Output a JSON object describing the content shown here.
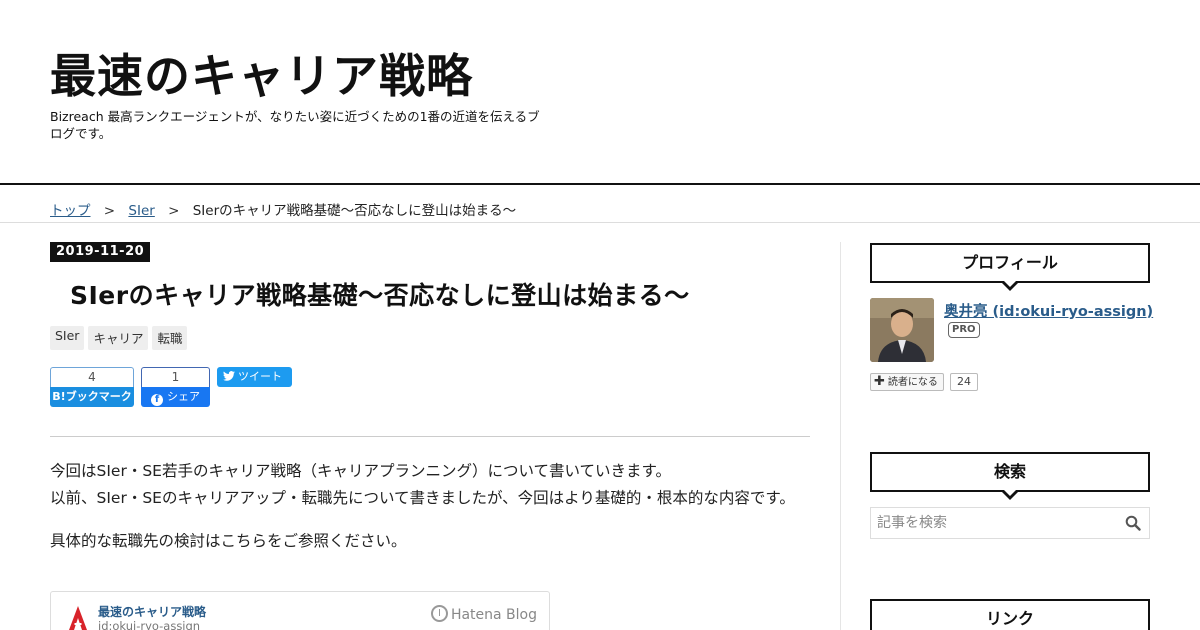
{
  "header": {
    "title": "最速のキャリア戦略",
    "description": "Bizreach 最高ランクエージェントが、なりたい姿に近づくための1番の近道を伝えるブログです。"
  },
  "breadcrumb": {
    "items": [
      "トップ",
      "SIer"
    ],
    "separator": ">",
    "current": "SIerのキャリア戦略基礎～否応なしに登山は始まる～"
  },
  "entry": {
    "date": "2019-11-20",
    "title": "SIerのキャリア戦略基礎～否応なしに登山は始まる～",
    "categories": [
      "SIer",
      "キャリア",
      "転職"
    ],
    "share": {
      "hatena_count": "4",
      "hatena_label": "B!ブックマーク",
      "facebook_count": "1",
      "facebook_label": "シェア",
      "tweet_label": "ツイート"
    },
    "paragraphs": [
      "今回はSIer・SE若手のキャリア戦略（キャリアプランニング）について書いていきます。",
      "以前、SIer・SEのキャリアアップ・転職先について書きましたが、今回はより基礎的・根本的な内容です。",
      "具体的な転職先の検討はこちらをご参照ください。"
    ],
    "embed": {
      "blog_title": "最速のキャリア戦略",
      "author": "id:okui-ryo-assign",
      "brand": "Hatena Blog"
    }
  },
  "sidebar": {
    "profile": {
      "heading": "プロフィール",
      "name": "奥井亮 (id:okui-ryo-assign)",
      "badge": "PRO",
      "subscribe_label": "読者になる",
      "subscriber_count": "24"
    },
    "search": {
      "heading": "検索",
      "placeholder": "記事を検索"
    },
    "links": {
      "heading": "リンク"
    }
  },
  "colors": {
    "link": "#2a5c8a",
    "hatena_blue": "#1a8ee0",
    "facebook_blue": "#1877f2",
    "twitter_blue": "#1d9bf0",
    "header_rule": "#111111"
  }
}
